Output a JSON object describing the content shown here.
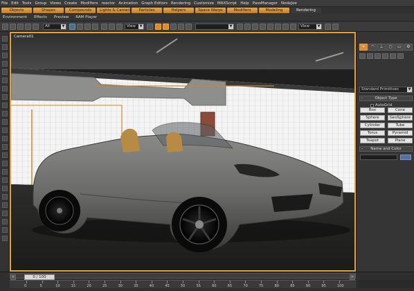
{
  "menu": [
    "File",
    "Edit",
    "Tools",
    "Group",
    "Views",
    "Create",
    "Modifiers",
    "reactor",
    "Animation",
    "Graph Editors",
    "Rendering",
    "Customize",
    "MAXScript",
    "Help",
    "PassManager",
    "NodeJoe"
  ],
  "ribbon_tabs": [
    {
      "label": "Objects",
      "active": false
    },
    {
      "label": "Shapes",
      "active": false
    },
    {
      "label": "Compounds",
      "active": false
    },
    {
      "label": "Lights & Cameras",
      "active": false
    },
    {
      "label": "Particles",
      "active": false
    },
    {
      "label": "Helpers",
      "active": false
    },
    {
      "label": "Space Warps",
      "active": false
    },
    {
      "label": "Modifiers",
      "active": false
    },
    {
      "label": "Modeling",
      "active": false
    },
    {
      "label": "Rendering",
      "active": true
    }
  ],
  "subbar": [
    "Environment",
    "Effects",
    "Preview",
    "RAM Player"
  ],
  "toolbar": {
    "selection_filter": "All",
    "ref_coord": "View",
    "named_selection": "",
    "ref_coord_2": "View"
  },
  "viewport": {
    "label": "Camera01",
    "accent_color": "#e2a23a"
  },
  "command_panel": {
    "tabs": [
      "create-icon",
      "modify-icon",
      "hierarchy-icon",
      "motion-icon",
      "display-icon",
      "utilities-icon"
    ],
    "category_icons": [
      "geometry-icon",
      "shapes-icon",
      "lights-icon",
      "cameras-icon",
      "helpers-icon",
      "spacewarps-icon",
      "systems-icon"
    ],
    "dropdown_value": "Standard Primitives",
    "object_type_header": "Object Type",
    "autogrid_label": "AutoGrid",
    "primitives": [
      "Box",
      "Cone",
      "Sphere",
      "GeoSphere",
      "Cylinder",
      "Tube",
      "Torus",
      "Pyramid",
      "Teapot",
      "Plane"
    ],
    "name_color_header": "Name and Color",
    "name_value": "",
    "color_swatch": "#5470a8"
  },
  "timeline": {
    "frame_display": "0 / 100",
    "ruler_ticks": [
      "0",
      "5",
      "10",
      "15",
      "20",
      "25",
      "30",
      "35",
      "40",
      "45",
      "50",
      "55",
      "60",
      "65",
      "70",
      "75",
      "80",
      "85",
      "90",
      "95",
      "100"
    ],
    "current_frame": 0,
    "total_frames": 100
  }
}
